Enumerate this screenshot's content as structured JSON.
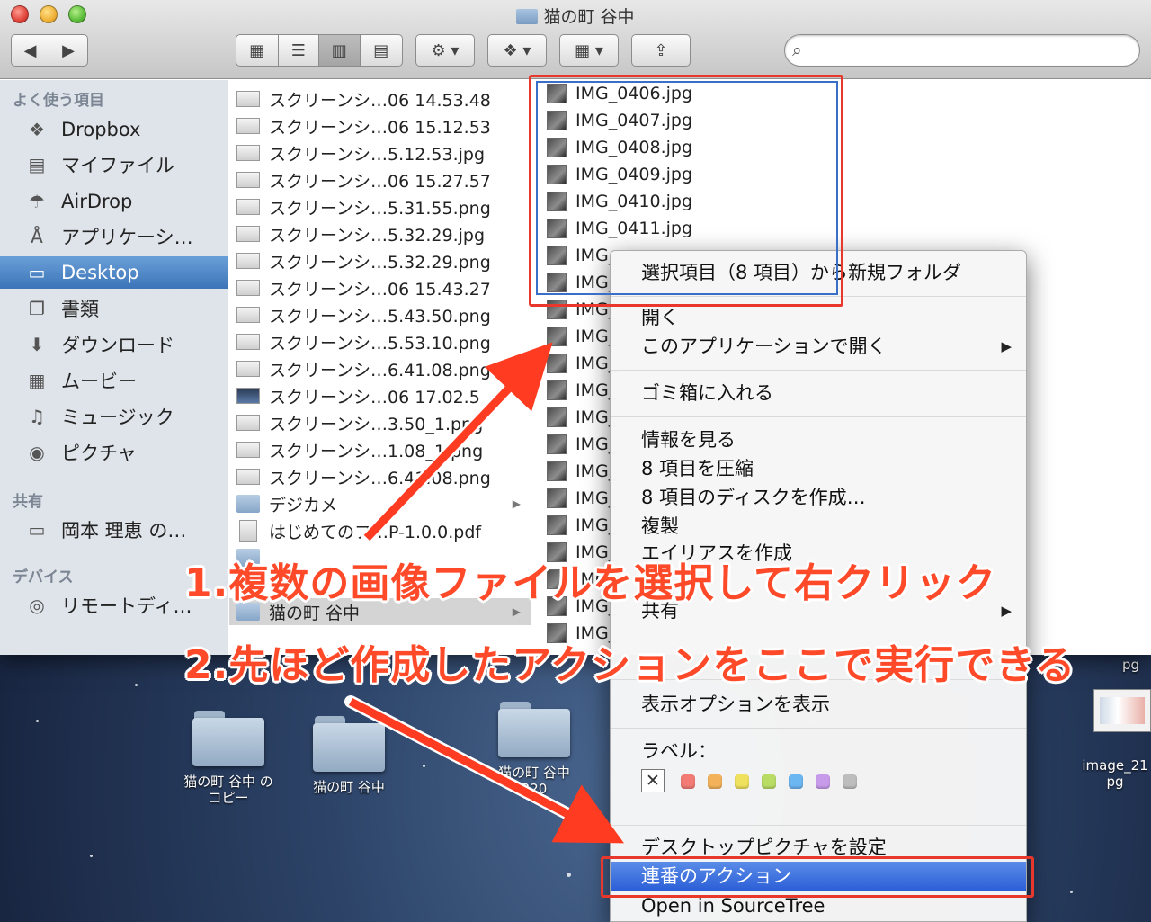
{
  "window": {
    "title": "猫の町 谷中"
  },
  "sidebar": {
    "sections": [
      {
        "heading": "よく使う項目",
        "items": [
          {
            "label": "Dropbox",
            "icon": "dropbox-icon"
          },
          {
            "label": "マイファイル",
            "icon": "all-files-icon"
          },
          {
            "label": "AirDrop",
            "icon": "airdrop-icon"
          },
          {
            "label": "アプリケーシ…",
            "icon": "applications-icon"
          },
          {
            "label": "Desktop",
            "icon": "desktop-icon",
            "selected": true
          },
          {
            "label": "書類",
            "icon": "documents-icon"
          },
          {
            "label": "ダウンロード",
            "icon": "downloads-icon"
          },
          {
            "label": "ムービー",
            "icon": "movies-icon"
          },
          {
            "label": "ミュージック",
            "icon": "music-icon"
          },
          {
            "label": "ピクチャ",
            "icon": "camera-icon"
          }
        ]
      },
      {
        "heading": "共有",
        "items": [
          {
            "label": "岡本 理恵 の…",
            "icon": "computer-icon"
          }
        ]
      },
      {
        "heading": "デバイス",
        "items": [
          {
            "label": "リモートディ…",
            "icon": "disc-icon"
          }
        ]
      }
    ]
  },
  "column1": {
    "rows": [
      "スクリーンシ…06 14.53.48",
      "スクリーンシ…06 15.12.53",
      "スクリーンシ…5.12.53.jpg",
      "スクリーンシ…06 15.27.57",
      "スクリーンシ…5.31.55.png",
      "スクリーンシ…5.32.29.jpg",
      "スクリーンシ…5.32.29.png",
      "スクリーンシ…06 15.43.27",
      "スクリーンシ…5.43.50.png",
      "スクリーンシ…5.53.10.png",
      "スクリーンシ…6.41.08.png",
      "スクリーンシ…06 17.02.5",
      "スクリーンシ…3.50_1.png",
      "スクリーンシ…1.08_1.png",
      "スクリーンシ…6.41.08.png",
      "デジカメ",
      "はじめてのフ…P-1.0.0.pdf",
      "",
      "猫の町 谷中"
    ]
  },
  "column2": {
    "rows": [
      "IMG_0406.jpg",
      "IMG_0407.jpg",
      "IMG_0408.jpg",
      "IMG_0409.jpg",
      "IMG_0410.jpg",
      "IMG_0411.jpg",
      "IMG_",
      "IMG_",
      "IMG_",
      "IMG_",
      "IMG_",
      "IMG_",
      "IMG_",
      "IMG_",
      "IMG_",
      "IMG_",
      "IMG_",
      "IMG_",
      "IMG_",
      "IMG_",
      "IMG_",
      "IMG_"
    ]
  },
  "menu": {
    "new_folder": "選択項目（8 項目）から新規フォルダ",
    "open": "開く",
    "open_with": "このアプリケーションで開く",
    "trash": "ゴミ箱に入れる",
    "get_info": "情報を見る",
    "compress": "8 項目を圧縮",
    "burn": "8 項目のディスクを作成…",
    "duplicate": "複製",
    "alias": "エイリアスを作成",
    "share": "共有",
    "view_options": "表示オプションを表示",
    "label_heading": "ラベル：",
    "label_none": "✕",
    "label_colors": [
      "#f27b76",
      "#f3b25a",
      "#efe05e",
      "#b8dc64",
      "#6cb6f2",
      "#c79bea",
      "#bdbdbd"
    ],
    "desktop_picture": "デスクトップピクチャを設定",
    "sequential_action": "連番のアクション",
    "open_sourcetree": "Open in SourceTree",
    "submenu_arrow": "▶"
  },
  "annotations": {
    "step1": "1.複数の画像ファイルを選択して右クリック",
    "step2": "2.先ほど作成したアクションをここで実行できる",
    "accent": "#e8372b"
  },
  "desktop": {
    "icons": [
      {
        "label": "猫の町 谷中 の\nコピー"
      },
      {
        "label": "猫の町 谷中"
      },
      {
        "label": "猫の町 谷中\n320"
      }
    ],
    "right_file_label": "image_21\npg",
    "right_top_label": "pg"
  }
}
